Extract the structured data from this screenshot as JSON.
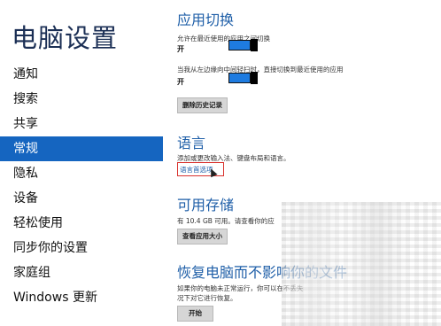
{
  "sidebar": {
    "title": "电脑设置",
    "items": [
      {
        "label": "通知"
      },
      {
        "label": "搜索"
      },
      {
        "label": "共享"
      },
      {
        "label": "常规"
      },
      {
        "label": "隐私"
      },
      {
        "label": "设备"
      },
      {
        "label": "轻松使用"
      },
      {
        "label": "同步你的设置"
      },
      {
        "label": "家庭组"
      },
      {
        "label": "Windows 更新"
      }
    ],
    "active_index": 3
  },
  "app_switching": {
    "title": "应用切换",
    "option1": {
      "description": "允许在最近使用的应用之间切换",
      "state": "开"
    },
    "option2": {
      "description": "当我从左边缘向中间轻扫时，直接切换到最近使用的应用",
      "state": "开"
    },
    "clear_history_button": "删除历史记录"
  },
  "language": {
    "title": "语言",
    "description": "添加或更改输入法、键盘布局和语言。",
    "link": "语言首选项"
  },
  "storage": {
    "title": "可用存储",
    "description": "有 10.4 GB 可用。请查看你的应",
    "button": "查看应用大小"
  },
  "recovery": {
    "title": "恢复电脑而不影响你的文件",
    "description_line1": "如果你的电脑未正常运行，你可以在不丢失",
    "description_line2": "况下对它进行恢复。",
    "button": "开始"
  },
  "colors": {
    "accent": "#1565c0",
    "toggle_on": "#1e7be0",
    "highlight": "#d9332f"
  }
}
